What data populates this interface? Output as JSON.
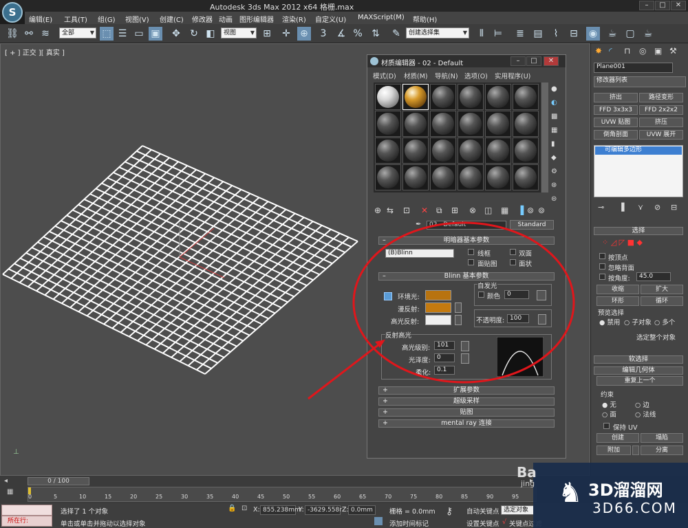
{
  "titlebar": {
    "app_logo": "S",
    "title": "Autodesk 3ds Max  2012 x64    格栅.max",
    "min": "–",
    "max": "□",
    "close": "✕"
  },
  "menu": [
    "编辑(E)",
    "工具(T)",
    "组(G)",
    "视图(V)",
    "创建(C)",
    "修改器",
    "动画",
    "图形编辑器",
    "渲染(R)",
    "自定义(U)",
    "MAXScript(M)",
    "帮助(H)"
  ],
  "toolbar": {
    "selection_filter": "全部",
    "ref_coord": "视图",
    "named_selection": "创建选择集",
    "snap_label": "3"
  },
  "viewport": {
    "label": "[ + ] 正交 ][ 真实 ]",
    "grid_color": "#ffffff"
  },
  "material_editor": {
    "title": "材质编辑器 - 02 - Default",
    "menu": [
      "模式(D)",
      "材质(M)",
      "导航(N)",
      "选项(O)",
      "实用程序(U)"
    ],
    "material_name": "02 - Default",
    "material_type": "Standard",
    "shader_rollout": "明暗器基本参数",
    "shader_type": "(B)Blinn",
    "wire": "线框",
    "two_sided": "双面",
    "face_map": "面贴图",
    "faceted": "面状",
    "blinn_rollout": "Blinn 基本参数",
    "self_illum": "自发光",
    "color_label": "颜色",
    "color_value": "0",
    "ambient": "环境光:",
    "diffuse": "漫反射:",
    "specular": "高光反射:",
    "opacity_label": "不透明度:",
    "opacity_value": "100",
    "spec_highlights": "反射高光",
    "spec_level_label": "高光级别:",
    "spec_level": "101",
    "gloss_label": "光泽度:",
    "gloss": "0",
    "soften_label": "柔化:",
    "soften": "0.1",
    "rollouts": [
      "扩展参数",
      "超级采样",
      "贴图",
      "mental ray 连接"
    ],
    "colors": {
      "ambient": "#b8730f",
      "diffuse": "#c47a10",
      "specular": "#efefef"
    }
  },
  "command_panel": {
    "object_name": "Plane001",
    "modifier_list": "修改器列表",
    "mod_buttons": [
      "挤出",
      "路径变形",
      "FFD 3x3x3",
      "FFD 2x2x2",
      "UVW 贴图",
      "挤压",
      "倒角剖面",
      "UVW 展开"
    ],
    "stack_item": "可编辑多边形",
    "selection_head": "选择",
    "by_vertex": "按顶点",
    "ignore_backface": "忽略背面",
    "by_angle": "按角度:",
    "angle_value": "45.0",
    "shrink": "收缩",
    "grow": "扩大",
    "ring": "环形",
    "loop": "循环",
    "preview_selection": "预览选择",
    "disabled": "禁用",
    "subobject": "子对象",
    "multi": "多个",
    "select_whole": "选定整个对象",
    "soft_selection": "软选择",
    "edit_geometry": "编辑几何体",
    "repeat_last": "重复上一个",
    "constraints": "约束",
    "c_none": "无",
    "c_edge": "边",
    "c_face": "面",
    "c_normal": "法线",
    "preserve_uv": "保持 UV",
    "create": "创建",
    "collapse": "塌陷",
    "attach": "附加",
    "detach": "分离"
  },
  "timeline": {
    "frame": "0 / 100",
    "ticks": [
      "0",
      "5",
      "10",
      "15",
      "20",
      "25",
      "30",
      "35",
      "40",
      "45",
      "50",
      "55",
      "60",
      "65",
      "70",
      "75",
      "80",
      "85",
      "90",
      "95"
    ]
  },
  "status": {
    "script_label": "所在行:",
    "selected": "选择了 1 个对象",
    "prompt": "单击或单击并拖动以选择对象",
    "x_label": "X:",
    "x_value": "855.238mm",
    "y_label": "Y:",
    "y_value": "-3629.558r",
    "z_label": "Z:",
    "z_value": "0.0mm",
    "grid": "栅格 = 0.0mm",
    "add_time_tag": "添加时间标记",
    "auto_key": "自动关键点",
    "set_key": "设置关键点",
    "key_mode": "选定对象",
    "key_filter": "关键点过滤"
  },
  "watermark": {
    "brand": "3D溜溜网",
    "url": "3D66.COM",
    "baidu": "Ba",
    "jing": "jing"
  }
}
